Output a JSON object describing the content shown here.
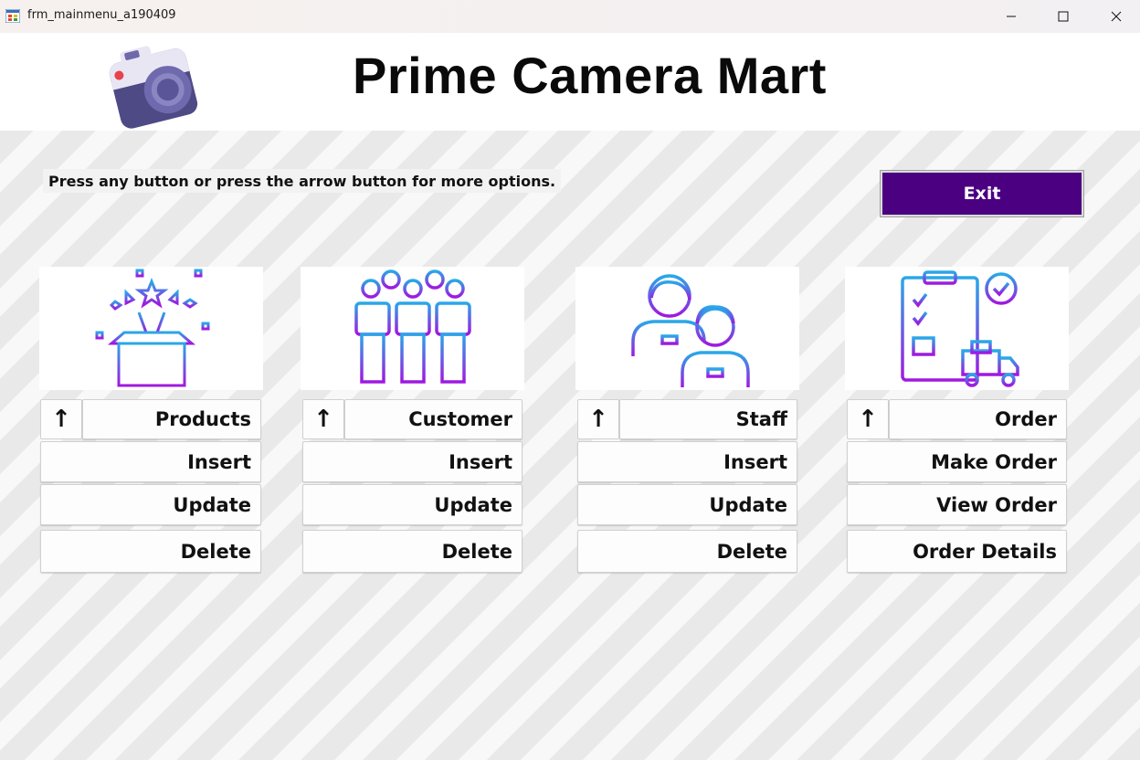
{
  "window": {
    "title": "frm_mainmenu_a190409",
    "controls": [
      "minimize-icon",
      "maximize-icon",
      "close-icon"
    ]
  },
  "header": {
    "brand": "Prime Camera Mart",
    "logo_icon": "camera-icon"
  },
  "hint_text": "Press any button or press the arrow button for more options.",
  "exit_label": "Exit",
  "colors": {
    "exit_bg": "#4b0082",
    "icon_gradient_start": "#29a8e8",
    "icon_gradient_end": "#a018e0"
  },
  "groups": [
    {
      "icon": "gift-box-icon",
      "arrow": "↑",
      "title": "Products",
      "actions": [
        "Insert",
        "Update",
        "Delete"
      ]
    },
    {
      "icon": "customers-icon",
      "arrow": "↑",
      "title": "Customer",
      "actions": [
        "Insert",
        "Update",
        "Delete"
      ]
    },
    {
      "icon": "staff-icon",
      "arrow": "↑",
      "title": "Staff",
      "actions": [
        "Insert",
        "Update",
        "Delete"
      ]
    },
    {
      "icon": "order-clipboard-icon",
      "arrow": "↑",
      "title": "Order",
      "actions": [
        "Make Order",
        "View Order",
        "Order Details"
      ]
    }
  ]
}
